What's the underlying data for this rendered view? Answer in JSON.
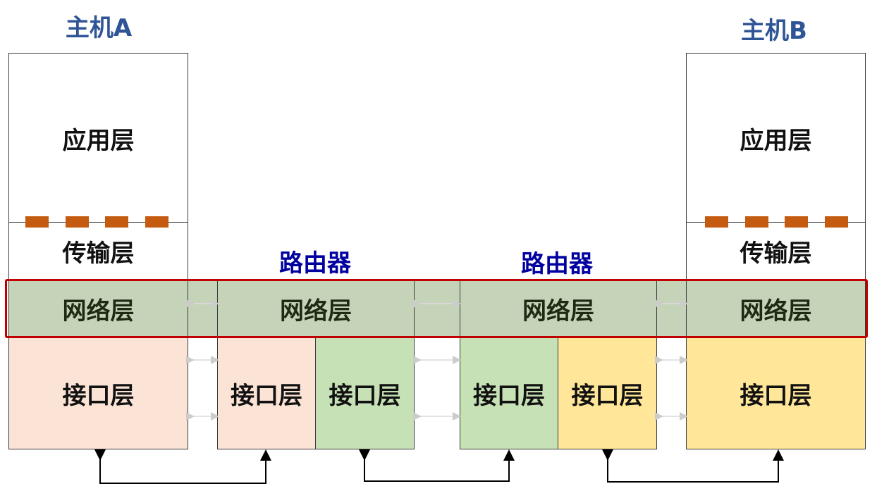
{
  "diagram": {
    "host_a": {
      "title": "主机A",
      "application_layer": "应用层",
      "transport_layer": "传输层",
      "network_layer": "网络层",
      "interface_layer": "接口层"
    },
    "router_1": {
      "title": "路由器",
      "network_layer": "网络层",
      "interface_left": "接口层",
      "interface_right": "接口层"
    },
    "router_2": {
      "title": "路由器",
      "network_layer": "网络层",
      "interface_left": "接口层",
      "interface_right": "接口层"
    },
    "host_b": {
      "title": "主机B",
      "application_layer": "应用层",
      "transport_layer": "传输层",
      "network_layer": "网络层",
      "interface_layer": "接口层"
    },
    "colors": {
      "title": "#2F5597",
      "router_title": "#0000A0",
      "network_fill": "#C5D4B8",
      "highlight": "#C00000",
      "boundary_dash": "#C55A11",
      "interface_host_a": "#FBE3D5",
      "interface_green": "#C7E1B6",
      "interface_yellow": "#FFE699"
    }
  }
}
